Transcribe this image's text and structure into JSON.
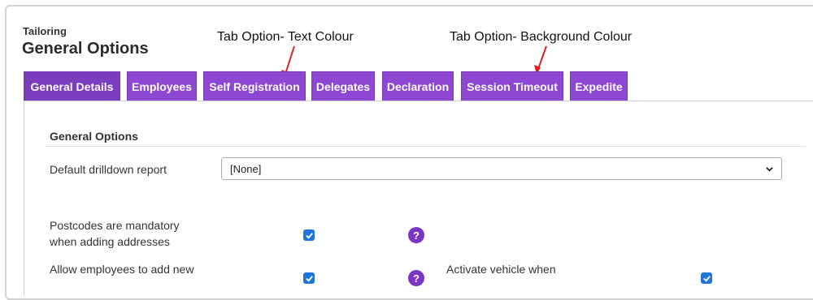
{
  "header": {
    "breadcrumb": "Tailoring",
    "title": "General Options"
  },
  "annotations": {
    "text_colour": "Tab Option- Text Colour",
    "background_colour": "Tab Option- Background Colour"
  },
  "tabs": [
    {
      "label": "General Details",
      "active": true
    },
    {
      "label": "Employees"
    },
    {
      "label": "Self Registration"
    },
    {
      "label": "Delegates"
    },
    {
      "label": "Declaration"
    },
    {
      "label": "Session Timeout"
    },
    {
      "label": "Expedite"
    }
  ],
  "section": {
    "title": "General Options",
    "default_drilldown": {
      "label": "Default drilldown report",
      "value": "[None]"
    },
    "postcodes": {
      "label_line1": "Postcodes are mandatory",
      "label_line2": "when adding addresses",
      "checked": true
    },
    "allow_employees": {
      "label_line1": "Allow employees to add new",
      "checked": true
    },
    "activate_vehicle": {
      "label_line1": "Activate vehicle when",
      "checked": true
    }
  },
  "colors": {
    "tab_bg": "#8e47d0",
    "checkbox": "#2174d9",
    "help_icon": "#7a35c4",
    "arrow": "#e02020"
  }
}
